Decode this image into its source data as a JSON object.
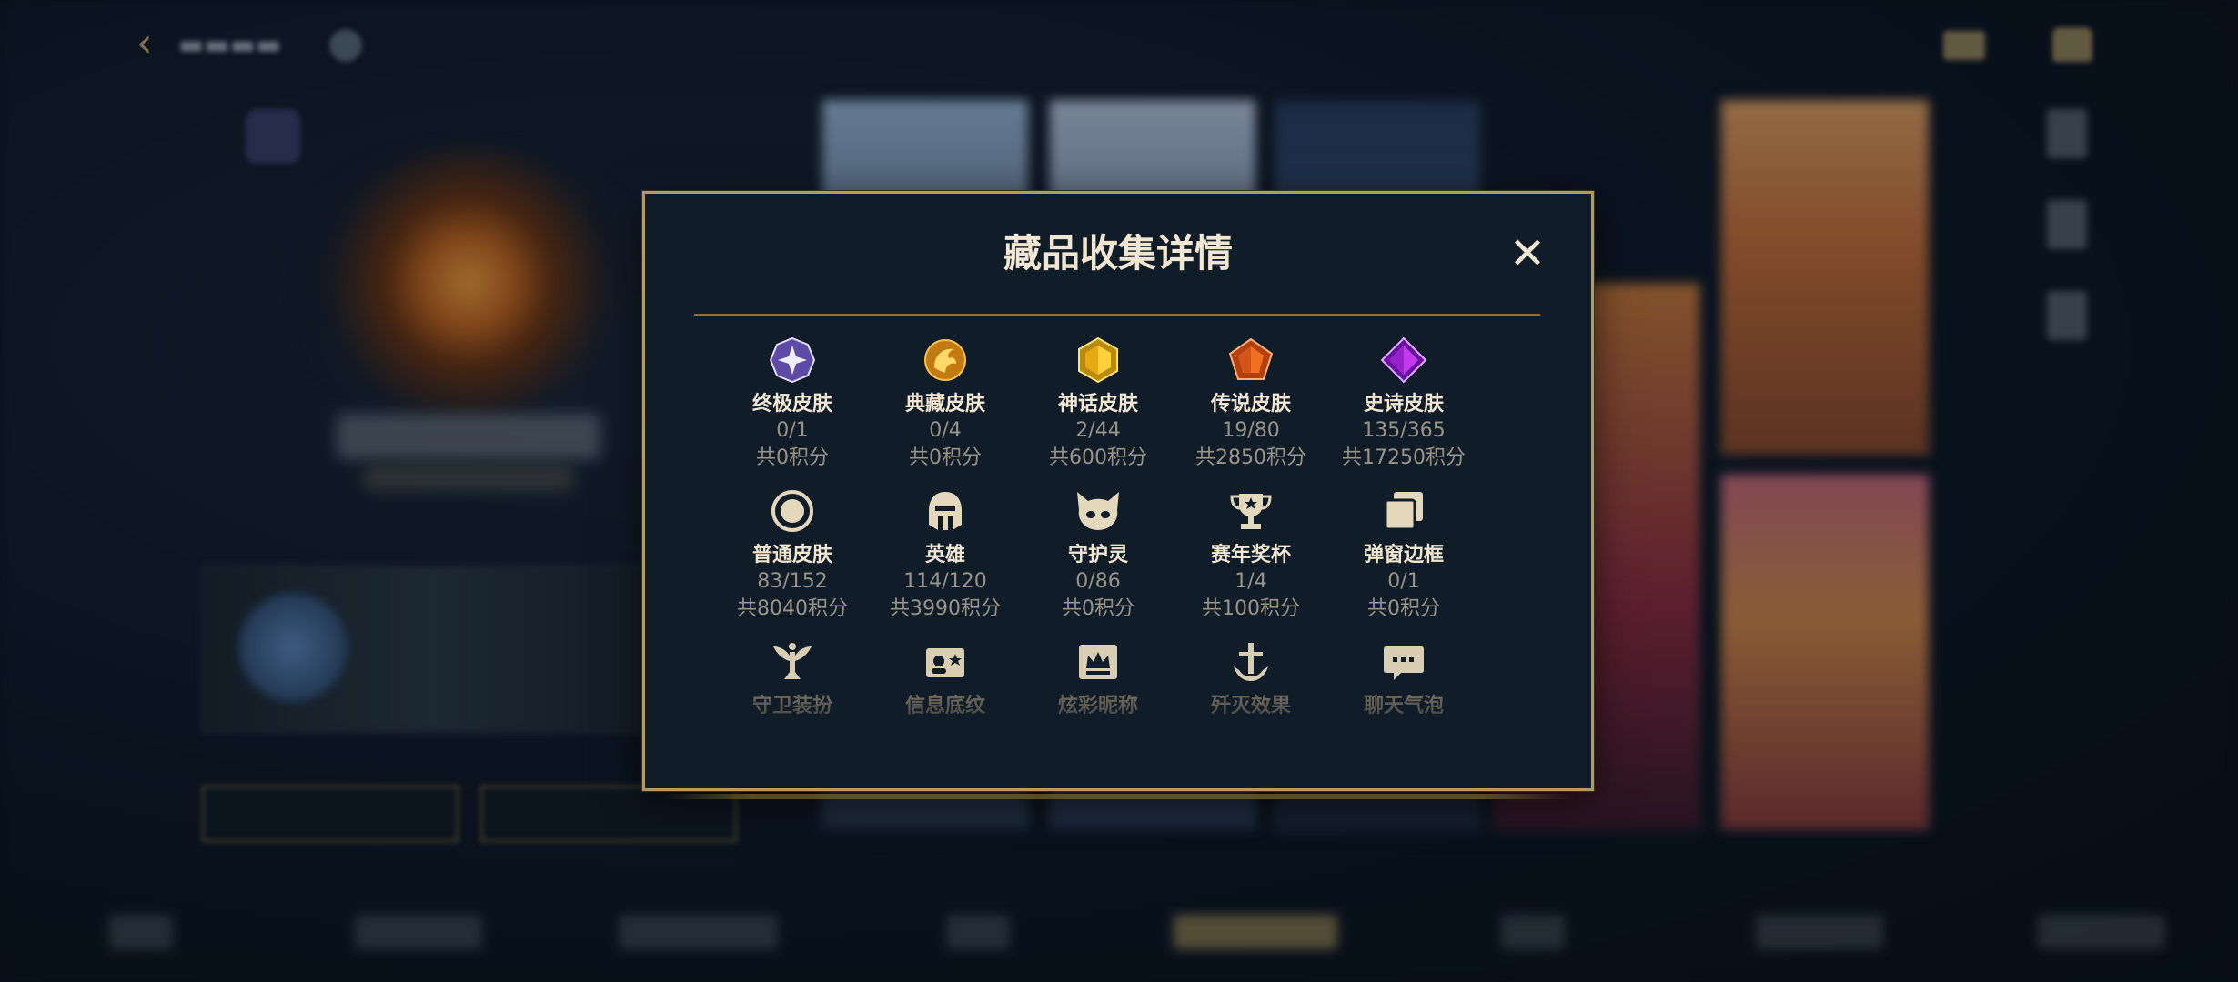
{
  "modal": {
    "title": "藏品收集详情",
    "close_symbol": "✕",
    "items": [
      {
        "label": "终极皮肤",
        "count": "0/1",
        "points": "共0积分",
        "icon": "ultimate-skin-icon",
        "color": "#b9a4ff"
      },
      {
        "label": "典藏皮肤",
        "count": "0/4",
        "points": "共0积分",
        "icon": "prestige-skin-icon",
        "color": "#d59a1e"
      },
      {
        "label": "神话皮肤",
        "count": "2/44",
        "points": "共600积分",
        "icon": "mythic-skin-icon",
        "color": "#e0b020"
      },
      {
        "label": "传说皮肤",
        "count": "19/80",
        "points": "共2850积分",
        "icon": "legendary-skin-icon",
        "color": "#e85a1a"
      },
      {
        "label": "史诗皮肤",
        "count": "135/365",
        "points": "共17250积分",
        "icon": "epic-skin-icon",
        "color": "#b02ad8"
      },
      {
        "label": "普通皮肤",
        "count": "83/152",
        "points": "共8040积分",
        "icon": "standard-skin-icon",
        "color": "#d8ccb0"
      },
      {
        "label": "英雄",
        "count": "114/120",
        "points": "共3990积分",
        "icon": "champion-helmet-icon",
        "color": "#d8ccb0"
      },
      {
        "label": "守护灵",
        "count": "0/86",
        "points": "共0积分",
        "icon": "guardian-spirit-icon",
        "color": "#d8ccb0"
      },
      {
        "label": "赛年奖杯",
        "count": "1/4",
        "points": "共100积分",
        "icon": "season-trophy-icon",
        "color": "#d8ccb0"
      },
      {
        "label": "弹窗边框",
        "count": "0/1",
        "points": "共0积分",
        "icon": "popup-frame-icon",
        "color": "#d8ccb0"
      },
      {
        "label": "守卫装扮",
        "icon": "ward-skin-icon",
        "color": "#d8ccb0"
      },
      {
        "label": "信息底纹",
        "icon": "info-banner-icon",
        "color": "#d8ccb0"
      },
      {
        "label": "炫彩昵称",
        "icon": "colorful-nickname-icon",
        "color": "#d8ccb0"
      },
      {
        "label": "歼灭效果",
        "icon": "elimination-effect-icon",
        "color": "#d8ccb0"
      },
      {
        "label": "聊天气泡",
        "icon": "chat-bubble-icon",
        "color": "#d8ccb0"
      }
    ]
  },
  "colors": {
    "gold": "#b39a5e",
    "panel": "#101c27",
    "title_text": "#f0e6d2",
    "muted_text": "#9a9488"
  }
}
